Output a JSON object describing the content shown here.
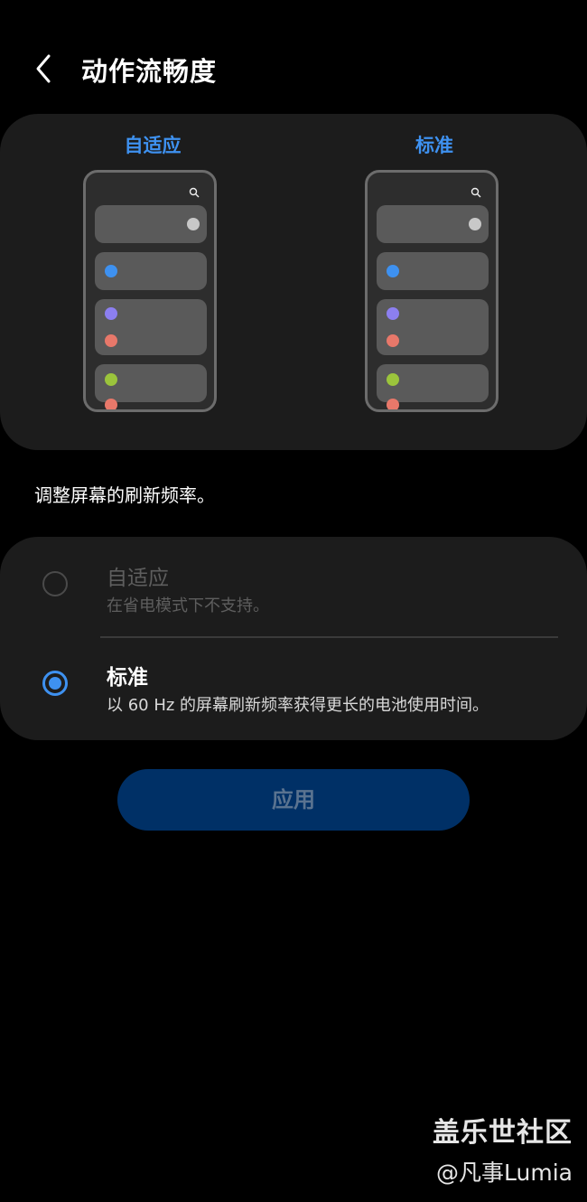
{
  "header": {
    "title": "动作流畅度",
    "back_icon": "chevron-left-icon"
  },
  "preview": {
    "left_label": "自适应",
    "right_label": "标准",
    "dot_colors": [
      "#c8c8c8",
      "#3e91f0",
      "#8c7ff0",
      "#e8786a",
      "#9bc43c",
      "#e8786a"
    ]
  },
  "description": "调整屏幕的刷新频率。",
  "options": [
    {
      "title": "自适应",
      "subtitle": "在省电模式下不支持。",
      "selected": false,
      "enabled": false
    },
    {
      "title": "标准",
      "subtitle": "以 60 Hz 的屏幕刷新频率获得更长的电池使用时间。",
      "selected": true,
      "enabled": true
    }
  ],
  "apply_button": {
    "label": "应用"
  },
  "watermark": {
    "line1": "盖乐世社区",
    "line2": "@凡事Lumia"
  },
  "colors": {
    "accent": "#3e91f0",
    "background": "#000000",
    "card": "#1c1c1c"
  }
}
